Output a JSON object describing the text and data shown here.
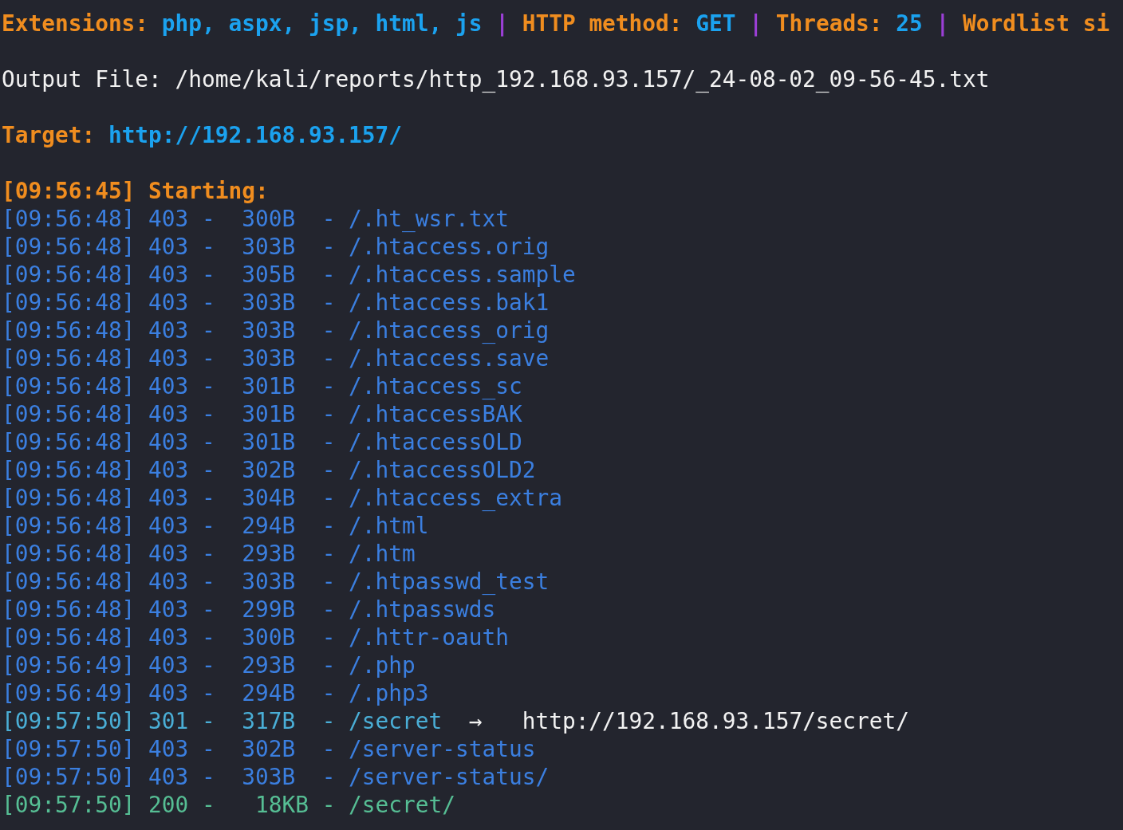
{
  "header": [
    {
      "kind": "label",
      "text": "Extensions:"
    },
    {
      "kind": "value",
      "text": "php, aspx, jsp, html, js"
    },
    {
      "kind": "separator",
      "text": "|"
    },
    {
      "kind": "label",
      "text": "HTTP method:"
    },
    {
      "kind": "value",
      "text": "GET"
    },
    {
      "kind": "separator",
      "text": "|"
    },
    {
      "kind": "label",
      "text": "Threads:"
    },
    {
      "kind": "value",
      "text": "25"
    },
    {
      "kind": "separator",
      "text": "|"
    },
    {
      "kind": "label",
      "text": "Wordlist si"
    }
  ],
  "output_file": "Output File: /home/kali/reports/http_192.168.93.157/_24-08-02_09-56-45.txt",
  "target": {
    "label": "Target:",
    "url": "http://192.168.93.157/"
  },
  "start_line": "[09:56:45] Starting:",
  "rows": [
    {
      "kind": "forbidden",
      "text": "[09:56:48] 403 -  300B  - /.ht_wsr.txt"
    },
    {
      "kind": "forbidden",
      "text": "[09:56:48] 403 -  303B  - /.htaccess.orig"
    },
    {
      "kind": "forbidden",
      "text": "[09:56:48] 403 -  305B  - /.htaccess.sample"
    },
    {
      "kind": "forbidden",
      "text": "[09:56:48] 403 -  303B  - /.htaccess.bak1"
    },
    {
      "kind": "forbidden",
      "text": "[09:56:48] 403 -  303B  - /.htaccess_orig"
    },
    {
      "kind": "forbidden",
      "text": "[09:56:48] 403 -  303B  - /.htaccess.save"
    },
    {
      "kind": "forbidden",
      "text": "[09:56:48] 403 -  301B  - /.htaccess_sc"
    },
    {
      "kind": "forbidden",
      "text": "[09:56:48] 403 -  301B  - /.htaccessBAK"
    },
    {
      "kind": "forbidden",
      "text": "[09:56:48] 403 -  301B  - /.htaccessOLD"
    },
    {
      "kind": "forbidden",
      "text": "[09:56:48] 403 -  302B  - /.htaccessOLD2"
    },
    {
      "kind": "forbidden",
      "text": "[09:56:48] 403 -  304B  - /.htaccess_extra"
    },
    {
      "kind": "forbidden",
      "text": "[09:56:48] 403 -  294B  - /.html"
    },
    {
      "kind": "forbidden",
      "text": "[09:56:48] 403 -  293B  - /.htm"
    },
    {
      "kind": "forbidden",
      "text": "[09:56:48] 403 -  303B  - /.htpasswd_test"
    },
    {
      "kind": "forbidden",
      "text": "[09:56:48] 403 -  299B  - /.htpasswds"
    },
    {
      "kind": "forbidden",
      "text": "[09:56:48] 403 -  300B  - /.httr-oauth"
    },
    {
      "kind": "forbidden",
      "text": "[09:56:49] 403 -  293B  - /.php"
    },
    {
      "kind": "forbidden",
      "text": "[09:56:49] 403 -  294B  - /.php3"
    },
    {
      "kind": "redirect",
      "text": "[09:57:50] 301 -  317B  - /secret",
      "arrow": "→",
      "target": "http://192.168.93.157/secret/"
    },
    {
      "kind": "forbidden",
      "text": "[09:57:50] 403 -  302B  - /server-status"
    },
    {
      "kind": "forbidden",
      "text": "[09:57:50] 403 -  303B  - /server-status/"
    },
    {
      "kind": "ok",
      "text": "[09:57:50] 200 -   18KB - /secret/"
    }
  ]
}
